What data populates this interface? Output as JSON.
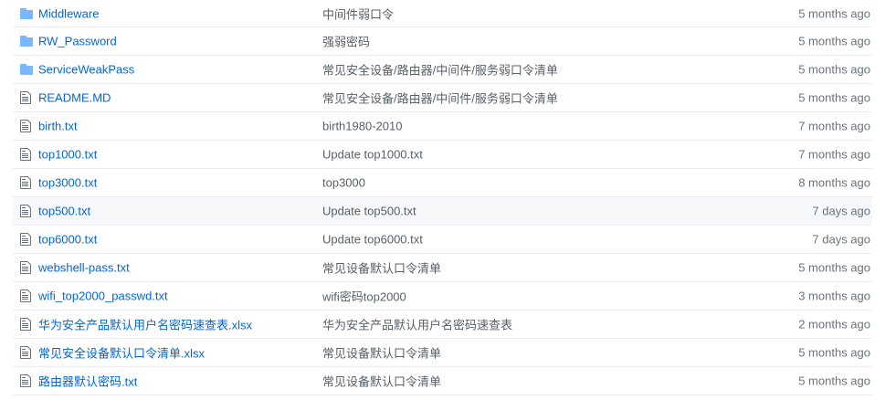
{
  "files": [
    {
      "icon": "folder-icon",
      "name": "Middleware",
      "message": "中间件弱口令",
      "age": "5 months ago",
      "highlight": false
    },
    {
      "icon": "folder-icon",
      "name": "RW_Password",
      "message": "强弱密码",
      "age": "5 months ago",
      "highlight": false
    },
    {
      "icon": "folder-icon",
      "name": "ServiceWeakPass",
      "message": "常见安全设备/路由器/中间件/服务弱口令清单",
      "age": "5 months ago",
      "highlight": false
    },
    {
      "icon": "file-icon",
      "name": "README.MD",
      "message": "常见安全设备/路由器/中间件/服务弱口令清单",
      "age": "5 months ago",
      "highlight": false
    },
    {
      "icon": "file-icon",
      "name": "birth.txt",
      "message": "birth1980-2010",
      "age": "7 months ago",
      "highlight": false
    },
    {
      "icon": "file-icon",
      "name": "top1000.txt",
      "message": "Update top1000.txt",
      "age": "7 months ago",
      "highlight": false
    },
    {
      "icon": "file-icon",
      "name": "top3000.txt",
      "message": "top3000",
      "age": "8 months ago",
      "highlight": false
    },
    {
      "icon": "file-icon",
      "name": "top500.txt",
      "message": "Update top500.txt",
      "age": "7 days ago",
      "highlight": true
    },
    {
      "icon": "file-icon",
      "name": "top6000.txt",
      "message": "Update top6000.txt",
      "age": "7 days ago",
      "highlight": false
    },
    {
      "icon": "file-icon",
      "name": "webshell-pass.txt",
      "message": "常见设备默认口令清单",
      "age": "5 months ago",
      "highlight": false
    },
    {
      "icon": "file-icon",
      "name": "wifi_top2000_passwd.txt",
      "message": "wifi密码top2000",
      "age": "3 months ago",
      "highlight": false
    },
    {
      "icon": "file-icon",
      "name": "华为安全产品默认用户名密码速查表.xlsx",
      "message": "华为安全产品默认用户名密码速查表",
      "age": "2 months ago",
      "highlight": false
    },
    {
      "icon": "file-icon",
      "name": "常见安全设备默认口令清单.xlsx",
      "message": "常见设备默认口令清单",
      "age": "5 months ago",
      "highlight": false
    },
    {
      "icon": "file-icon",
      "name": "路由器默认密码.txt",
      "message": "常见设备默认口令清单",
      "age": "5 months ago",
      "highlight": false
    }
  ],
  "colors": {
    "link": "#0366d6",
    "folder_icon": "#79b8ff",
    "file_icon": "#6a737d",
    "muted": "#586069",
    "border": "#eaecef",
    "highlight_bg": "#f6f8fa"
  }
}
